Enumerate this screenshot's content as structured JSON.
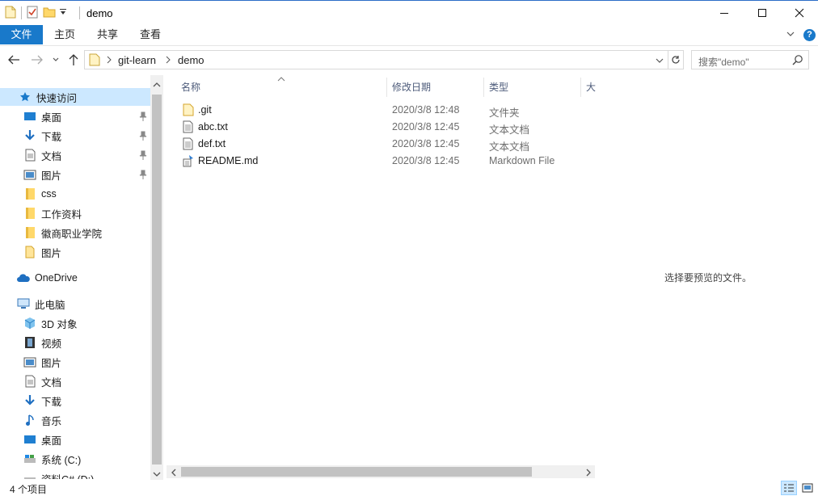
{
  "window": {
    "title": "demo"
  },
  "ribbon": {
    "file": "文件",
    "home": "主页",
    "share": "共享",
    "view": "查看",
    "help": "?"
  },
  "address": {
    "crumb1": "git-learn",
    "crumb2": "demo"
  },
  "search": {
    "placeholder": "搜索\"demo\""
  },
  "sidebar": {
    "quick_access": "快速访问",
    "quick_items": [
      {
        "label": "桌面",
        "icon": "desktop-icon",
        "pinned": true
      },
      {
        "label": "下载",
        "icon": "download-icon",
        "pinned": true
      },
      {
        "label": "文档",
        "icon": "document-icon",
        "pinned": true
      },
      {
        "label": "图片",
        "icon": "picture-icon",
        "pinned": true
      },
      {
        "label": "css",
        "icon": "folder-icon",
        "pinned": false
      },
      {
        "label": "工作资料",
        "icon": "folder-icon",
        "pinned": false
      },
      {
        "label": "徽商职业学院",
        "icon": "folder-icon",
        "pinned": false
      },
      {
        "label": "图片",
        "icon": "folder-icon",
        "pinned": false
      }
    ],
    "onedrive": "OneDrive",
    "this_pc": "此电脑",
    "pc_items": [
      {
        "label": "3D 对象",
        "icon": "cube-icon"
      },
      {
        "label": "视频",
        "icon": "video-icon"
      },
      {
        "label": "图片",
        "icon": "picture-icon"
      },
      {
        "label": "文档",
        "icon": "document-icon"
      },
      {
        "label": "下载",
        "icon": "download-icon"
      },
      {
        "label": "音乐",
        "icon": "music-icon"
      },
      {
        "label": "桌面",
        "icon": "desktop-icon"
      },
      {
        "label": "系统 (C:)",
        "icon": "drive-icon"
      },
      {
        "label": "资料C# (D:)",
        "icon": "drive-icon"
      }
    ]
  },
  "columns": {
    "name": "名称",
    "modified": "修改日期",
    "type": "类型",
    "size": "大"
  },
  "files": [
    {
      "name": ".git",
      "date": "2020/3/8 12:48",
      "type": "文件夹",
      "icon": "folder-icon"
    },
    {
      "name": "abc.txt",
      "date": "2020/3/8 12:45",
      "type": "文本文档",
      "icon": "text-file-icon"
    },
    {
      "name": "def.txt",
      "date": "2020/3/8 12:45",
      "type": "文本文档",
      "icon": "text-file-icon"
    },
    {
      "name": "README.md",
      "date": "2020/3/8 12:45",
      "type": "Markdown File",
      "icon": "markdown-file-icon"
    }
  ],
  "preview": {
    "message": "选择要预览的文件。"
  },
  "status": {
    "count": "4 个项目"
  },
  "colors": {
    "accent": "#1979ca",
    "selected": "#cce8ff",
    "folder": "#ffd86a"
  }
}
